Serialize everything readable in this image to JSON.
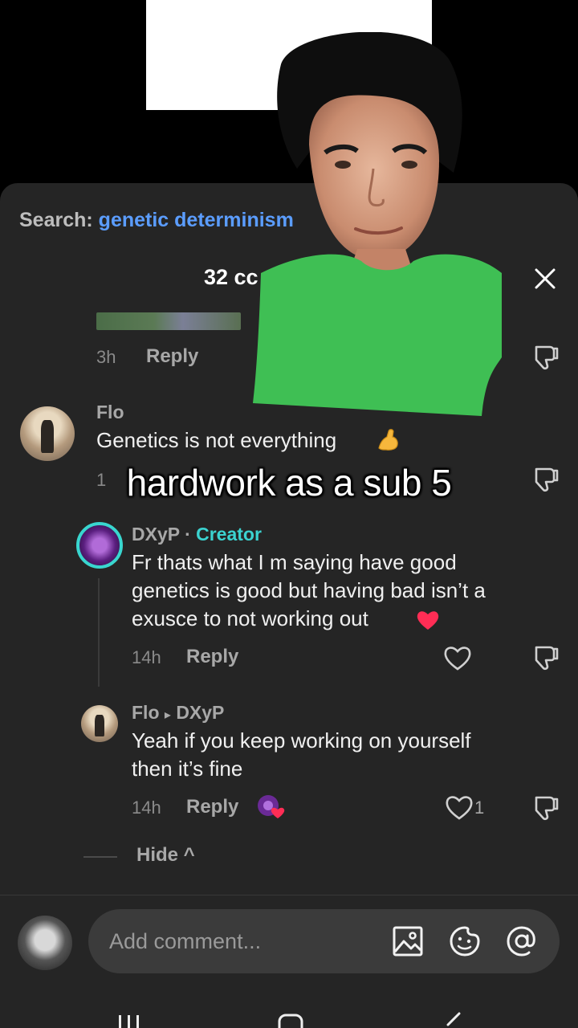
{
  "search": {
    "prefix": "Search:",
    "query": "genetic determinism"
  },
  "header": {
    "count_text": "32 cc"
  },
  "comments": [
    {
      "time": "3h",
      "reply_label": "Reply"
    },
    {
      "author": "Flo",
      "text": "Genetics is not everything",
      "time": "1"
    },
    {
      "author": "DXyP",
      "separator": "·",
      "badge": "Creator",
      "text_lines": [
        "Fr thats what I m saying have good",
        "genetics is good but having bad isn’t a",
        "exusce to not working out"
      ],
      "time": "14h",
      "reply_label": "Reply"
    },
    {
      "author": "Flo",
      "arrow": "▸",
      "reply_to": "DXyP",
      "text_lines": [
        "Yeah if you keep working on yourself",
        "then it’s fine"
      ],
      "time": "14h",
      "reply_label": "Reply",
      "like_count": "1"
    }
  ],
  "caption": "hardwork as a sub 5",
  "thread": {
    "hide_label": "Hide ^"
  },
  "composer": {
    "placeholder": "Add comment..."
  },
  "colors": {
    "accent_blue": "#5b9dff",
    "creator_teal": "#3bd3d0",
    "sheet_bg": "#252525",
    "heart_red": "#ff2d55"
  },
  "icons": [
    "close-icon",
    "dislike-icon",
    "heart-icon",
    "image-icon",
    "sticker-icon",
    "mention-icon",
    "muscle-emoji",
    "red-heart-emoji"
  ]
}
